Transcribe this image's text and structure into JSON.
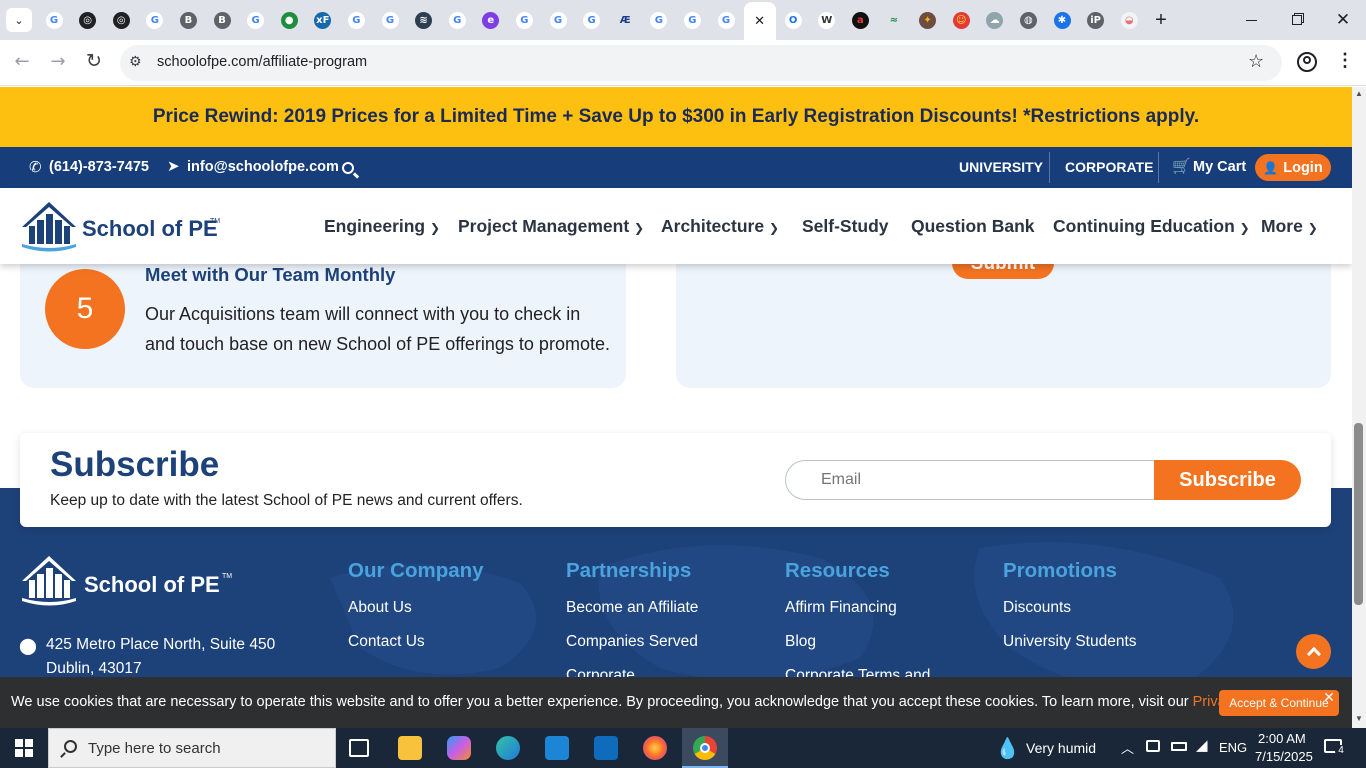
{
  "browser": {
    "tabs": [
      {
        "icon": "google-icon",
        "color": "#ffffff",
        "glyph": "G",
        "fg": "#4285f4"
      },
      {
        "icon": "openai-icon",
        "color": "#202124",
        "glyph": "◎",
        "fg": "#fff"
      },
      {
        "icon": "openai-icon",
        "color": "#202124",
        "glyph": "◎",
        "fg": "#fff"
      },
      {
        "icon": "google-icon",
        "color": "#ffffff",
        "glyph": "G",
        "fg": "#4285f4"
      },
      {
        "icon": "b-icon",
        "color": "#5f6368",
        "glyph": "B",
        "fg": "#fff"
      },
      {
        "icon": "b-icon",
        "color": "#5f6368",
        "glyph": "B",
        "fg": "#fff"
      },
      {
        "icon": "google-icon",
        "color": "#ffffff",
        "glyph": "G",
        "fg": "#4285f4"
      },
      {
        "icon": "globe-green-icon",
        "color": "#1e8e3e",
        "glyph": "●",
        "fg": "#fff"
      },
      {
        "icon": "excel-icon",
        "color": "#1769aa",
        "glyph": "xF",
        "fg": "#fff"
      },
      {
        "icon": "google-icon",
        "color": "#ffffff",
        "glyph": "G",
        "fg": "#4285f4"
      },
      {
        "icon": "google-icon",
        "color": "#ffffff",
        "glyph": "G",
        "fg": "#4285f4"
      },
      {
        "icon": "stack-icon",
        "color": "#2c3e50",
        "glyph": "≋",
        "fg": "#fff"
      },
      {
        "icon": "google-icon",
        "color": "#ffffff",
        "glyph": "G",
        "fg": "#4285f4"
      },
      {
        "icon": "e-icon",
        "color": "#7b3fe4",
        "glyph": "e",
        "fg": "#fff"
      },
      {
        "icon": "google-icon",
        "color": "#ffffff",
        "glyph": "G",
        "fg": "#4285f4"
      },
      {
        "icon": "google-icon",
        "color": "#ffffff",
        "glyph": "G",
        "fg": "#4285f4"
      },
      {
        "icon": "google-icon",
        "color": "#ffffff",
        "glyph": "G",
        "fg": "#4285f4"
      },
      {
        "icon": "signature-icon",
        "color": "#dfe3e9",
        "glyph": "Æ",
        "fg": "#1a3d8a"
      },
      {
        "icon": "google-icon",
        "color": "#ffffff",
        "glyph": "G",
        "fg": "#4285f4"
      },
      {
        "icon": "google-icon",
        "color": "#ffffff",
        "glyph": "G",
        "fg": "#4285f4"
      },
      {
        "icon": "google-icon",
        "color": "#ffffff",
        "glyph": "G",
        "fg": "#4285f4"
      },
      {
        "icon": "close-tab-icon",
        "color": "#ffffff",
        "glyph": "✕",
        "fg": "#202124",
        "active": true
      },
      {
        "icon": "ring-icon",
        "color": "#ffffff",
        "glyph": "O",
        "fg": "#1a73e8"
      },
      {
        "icon": "w-icon",
        "color": "#ffffff",
        "glyph": "W",
        "fg": "#333"
      },
      {
        "icon": "a-icon",
        "color": "#111111",
        "glyph": "a",
        "fg": "#e53935"
      },
      {
        "icon": "wave-icon",
        "color": "#dfe3e9",
        "glyph": "≈",
        "fg": "#1e8e3e"
      },
      {
        "icon": "game-icon",
        "color": "#6d4c41",
        "glyph": "✦",
        "fg": "#ffb300"
      },
      {
        "icon": "face-icon",
        "color": "#e53935",
        "glyph": "☺",
        "fg": "#ffeb3b"
      },
      {
        "icon": "cloud-icon",
        "color": "#90a4ae",
        "glyph": "☁",
        "fg": "#fff"
      },
      {
        "icon": "globe-icon",
        "color": "#5f6368",
        "glyph": "◍",
        "fg": "#fff"
      },
      {
        "icon": "gear-blue-icon",
        "color": "#1a73e8",
        "glyph": "✱",
        "fg": "#fff"
      },
      {
        "icon": "ip-icon",
        "color": "#5f6368",
        "glyph": "iP",
        "fg": "#fff"
      },
      {
        "icon": "pill-icon",
        "color": "#f1f3f4",
        "glyph": "◒",
        "fg": "#e57373"
      }
    ],
    "url": "schoolofpe.com/affiliate-program"
  },
  "promo": {
    "text": "Price Rewind: 2019 Prices for a Limited Time + Save Up to $300 in Early Registration Discounts! *Restrictions apply."
  },
  "infobar": {
    "phone": "(614)-873-7475",
    "email": "info@schoolofpe.com",
    "university": "UNIVERSITY",
    "corporate": "CORPORATE",
    "cart": "My Cart",
    "login": "Login"
  },
  "nav": {
    "logo_text": "School of PE",
    "logo_tm": "TM",
    "items": [
      {
        "label": "Engineering",
        "caret": true
      },
      {
        "label": "Project Management",
        "caret": true
      },
      {
        "label": "Architecture",
        "caret": true
      },
      {
        "label": "Self-Study",
        "caret": false
      },
      {
        "label": "Question Bank",
        "caret": false
      },
      {
        "label": "Continuing Education",
        "caret": true
      },
      {
        "label": "More",
        "caret": true
      }
    ]
  },
  "step": {
    "number": "5",
    "title": "Meet with Our Team Monthly",
    "body_line1": "Our Acquisitions team will connect with you to check in",
    "body_line2": "and touch base on new School of PE offerings to promote."
  },
  "form": {
    "submit": "Submit"
  },
  "subscribe": {
    "title": "Subscribe",
    "subtitle": "Keep up to date with the latest School of PE news and current offers.",
    "email_placeholder": "Email",
    "button": "Subscribe"
  },
  "footer": {
    "logo_text": "School of PE",
    "logo_tm": "TM",
    "address_line1": "425 Metro Place North, Suite 450",
    "address_line2": "Dublin, 43017",
    "columns": [
      {
        "heading": "Our Company",
        "links": [
          "About Us",
          "Contact Us"
        ]
      },
      {
        "heading": "Partnerships",
        "links": [
          "Become an Affiliate",
          "Companies Served",
          "Corporate"
        ]
      },
      {
        "heading": "Resources",
        "links": [
          "Affirm Financing",
          "Blog",
          "Corporate Terms and"
        ]
      },
      {
        "heading": "Promotions",
        "links": [
          "Discounts",
          "University Students"
        ]
      }
    ]
  },
  "cookie": {
    "text": "We use cookies that are necessary to operate this website and to offer you a better experience. By proceeding, you acknowledge that you accept these cookies. To learn more, visit our ",
    "link": "Privacy Policy.",
    "accept": "Accept & Continue"
  },
  "taskbar": {
    "search_placeholder": "Type here to search",
    "weather": "Very humid",
    "lang": "ENG",
    "time": "2:00 AM",
    "date": "7/15/2025",
    "notifications": "4"
  },
  "colors": {
    "accent_orange": "#f37321",
    "navy": "#173e7a",
    "promo_yellow": "#fec010",
    "link_blue": "#4aa3de"
  }
}
